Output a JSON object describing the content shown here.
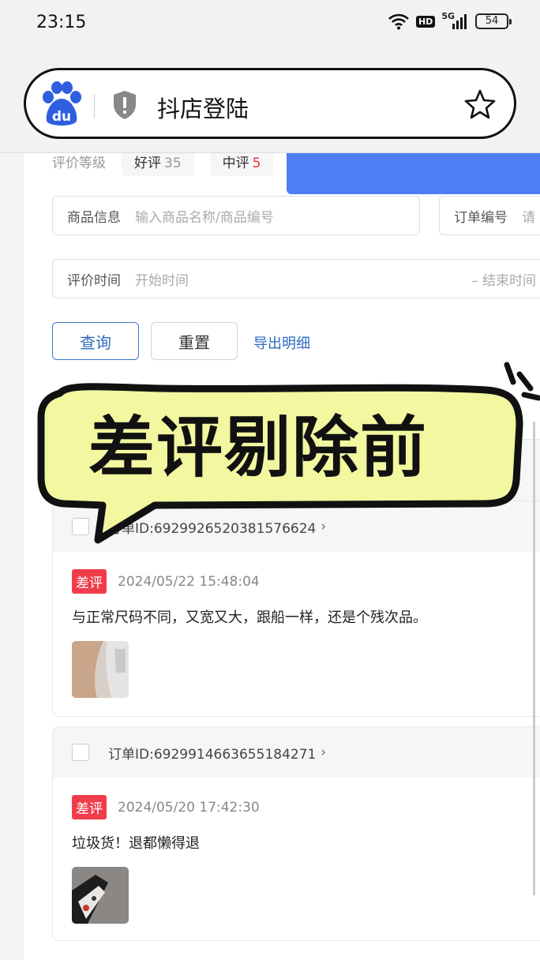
{
  "status_bar": {
    "time": "23:15",
    "hd_badge": "HD",
    "network": "5G",
    "battery": "54",
    "icons": [
      "wifi-icon",
      "signal-icon",
      "battery-icon"
    ]
  },
  "browser": {
    "url_text": "抖店登陆",
    "icons": [
      "baidu-logo-icon",
      "shield-icon",
      "star-icon"
    ]
  },
  "filters": {
    "grade_label": "评价等级",
    "grade_chips": [
      {
        "label": "好评",
        "count": "35"
      },
      {
        "label": "中评",
        "count": "5"
      }
    ],
    "product_label": "商品信息",
    "product_placeholder": "输入商品名称/商品编号",
    "order_label": "订单编号",
    "order_placeholder": "请",
    "time_label": "评价时间",
    "start_placeholder": "开始时间",
    "end_placeholder": "– 结束时间"
  },
  "actions": {
    "query": "查询",
    "reset": "重置",
    "export": "导出明细"
  },
  "sticker": {
    "text": "差评剔除前"
  },
  "reviews": [
    {
      "order_id": "订单ID:6929926520381576624",
      "tag": "差评",
      "timestamp": "2024/05/22 15:48:04",
      "text": "与正常尺码不同，又宽又大，跟船一样，还是个残次品。"
    },
    {
      "order_id": "订单ID:6929914663655184271",
      "tag": "差评",
      "timestamp": "2024/05/20 17:42:30",
      "text": "垃圾货！退都懒得退"
    }
  ],
  "colors": {
    "accent_blue": "#2d6bc0",
    "banner_blue": "#4d7ef7",
    "bad_tag": "#f03c4a",
    "sticker_fill": "#f2f7a0"
  }
}
